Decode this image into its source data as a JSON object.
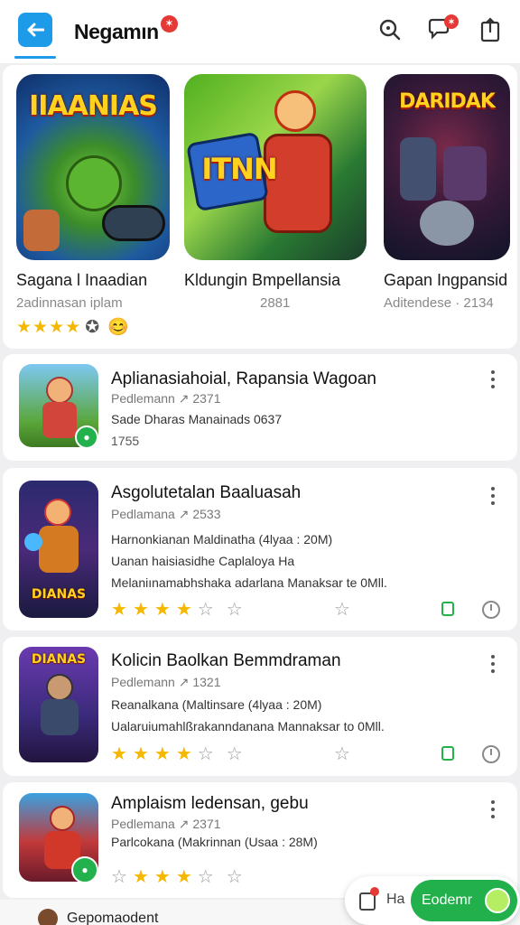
{
  "header": {
    "title": "Negamın",
    "title_badge": "✶",
    "notif_badge": "✶"
  },
  "featured": [
    {
      "art_text": "IIAANIAS",
      "name": "Sagana l Inaadian",
      "sub": "2adinnasan iplam",
      "rating_tail": "😊"
    },
    {
      "art_text": "ITNN",
      "name": "Kldungin Bmpellansia",
      "sub": "2881"
    },
    {
      "art_text": "DARIDAK",
      "name": "Gapan Ingpansid",
      "sub": "Aditendese · 2134"
    }
  ],
  "items": [
    {
      "title": "Aplianasiahoial, Rapansia Wagoan",
      "meta": "Pedlemann ↗ 2371",
      "lines": [
        "Sade Dharas Manainads 0637",
        "1755"
      ],
      "thumb_label": ""
    },
    {
      "title": "Asgolutetalan Baaluasah",
      "meta": "Pedlamana ↗ 2533",
      "lines": [
        "Harnonkianan Maldinatha (4lyaa : 20M)",
        "Uanan haisiasidhe Caplaloya Ha",
        "Melaniınamabhshaka adarlana Manaksar te 0Mll."
      ],
      "thumb_label": "DIANAS"
    },
    {
      "title": "Kolicin Baolkan Bemmdraman",
      "meta": "Pedlemann ↗ 1321",
      "lines": [
        "Reanalkana (Maltinsare (4lyaa : 20M)",
        "Ualaruiumahlßrakanndanana Mannaksar to 0Mll."
      ],
      "thumb_label": "DIANAS"
    },
    {
      "title": "Amplaism ledensan, gebu",
      "meta": "Pedlemana ↗ 2371",
      "lines": [
        "Parlcokana (Makrinnan (Usaa : 28M)"
      ],
      "thumb_label": ""
    }
  ],
  "bottom": {
    "username": "Gepomaodent",
    "pill_label": "Ha",
    "action_label": "Eodemr"
  }
}
